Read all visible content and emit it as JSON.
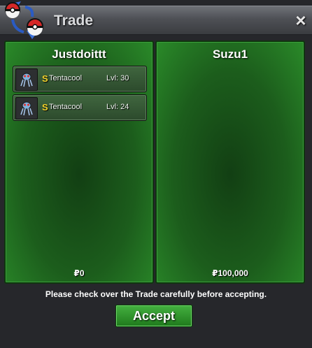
{
  "window": {
    "title": "Trade",
    "close_label": "×"
  },
  "left_panel": {
    "name": "Justdoittt",
    "items": [
      {
        "shiny_mark": "S",
        "name": "Tentacool",
        "level": "Lvl: 30"
      },
      {
        "shiny_mark": "S",
        "name": "Tentacool",
        "level": "Lvl: 24"
      }
    ],
    "money": "₽0"
  },
  "right_panel": {
    "name": "Suzu1",
    "money": "₽100,000"
  },
  "footer": {
    "notice": "Please check over the Trade carefully before accepting.",
    "accept_label": "Accept"
  }
}
